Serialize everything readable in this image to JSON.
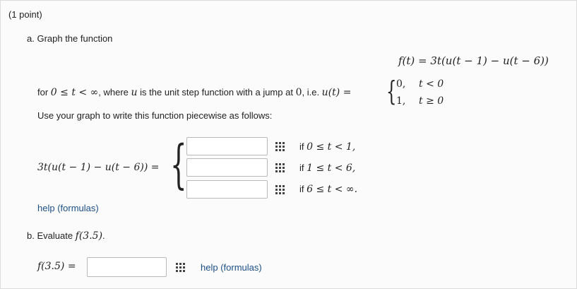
{
  "point": "(1 point)",
  "part_a": {
    "label": "a. Graph the function",
    "f_def": "f(t) = 3t(u(t − 1) − u(t − 6))",
    "for_pre": "for ",
    "range": "0 ≤ t < ∞",
    "mid": ", where ",
    "u": "u",
    "desc": " is the unit step function with a jump at ",
    "zero": "0",
    "ie": ", i.e. ",
    "u_def": "u(t) =",
    "case1_val": "0,",
    "case1_cond": "t < 0",
    "case2_val": "1,",
    "case2_cond": "t ≥ 0",
    "instruction": "Use your graph to write this function piecewise as follows:",
    "lhs": "3t(u(t − 1) − u(t − 6)) =",
    "rows": [
      {
        "value": "",
        "if": "if ",
        "cond": "0 ≤ t < 1,"
      },
      {
        "value": "",
        "if": "if ",
        "cond": "1 ≤ t < 6,"
      },
      {
        "value": "",
        "if": "if ",
        "cond": "6 ≤ t < ∞."
      }
    ],
    "help": "help (formulas)"
  },
  "part_b": {
    "label_pre": "b. Evaluate ",
    "label_math": "f(3.5)",
    "label_post": ".",
    "lhs": "f(3.5) =",
    "value": "",
    "help": "help (formulas)"
  },
  "colors": {
    "link": "#1b4f86",
    "border": "#b9b9b9"
  }
}
